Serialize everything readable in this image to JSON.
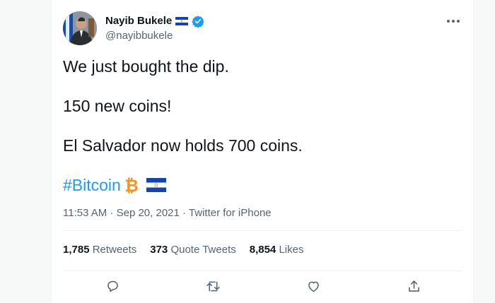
{
  "tweet": {
    "author": {
      "display_name": "Nayib Bukele",
      "handle": "@nayibbukele",
      "verified": true
    },
    "text": {
      "line1": "We just bought the dip.",
      "line2": "150 new coins!",
      "line3": "El Salvador now holds 700 coins.",
      "hashtag": "#Bitcoin"
    },
    "meta": {
      "time": "11:53 AM",
      "sep1": " · ",
      "date": "Sep 20, 2021",
      "sep2": " · ",
      "source": "Twitter for iPhone"
    },
    "stats": {
      "retweets_count": "1,785",
      "retweets_label": "Retweets",
      "quotes_count": "373",
      "quotes_label": "Quote Tweets",
      "likes_count": "8,854",
      "likes_label": "Likes"
    },
    "actions": [
      "reply-icon",
      "retweet-icon",
      "like-icon",
      "share-icon"
    ]
  },
  "colors": {
    "accent": "#1d9bf0",
    "text": "#0f1419",
    "secondary": "#536471",
    "flag_blue": "#0f47af",
    "bitcoin_orange": "#f7931a"
  }
}
